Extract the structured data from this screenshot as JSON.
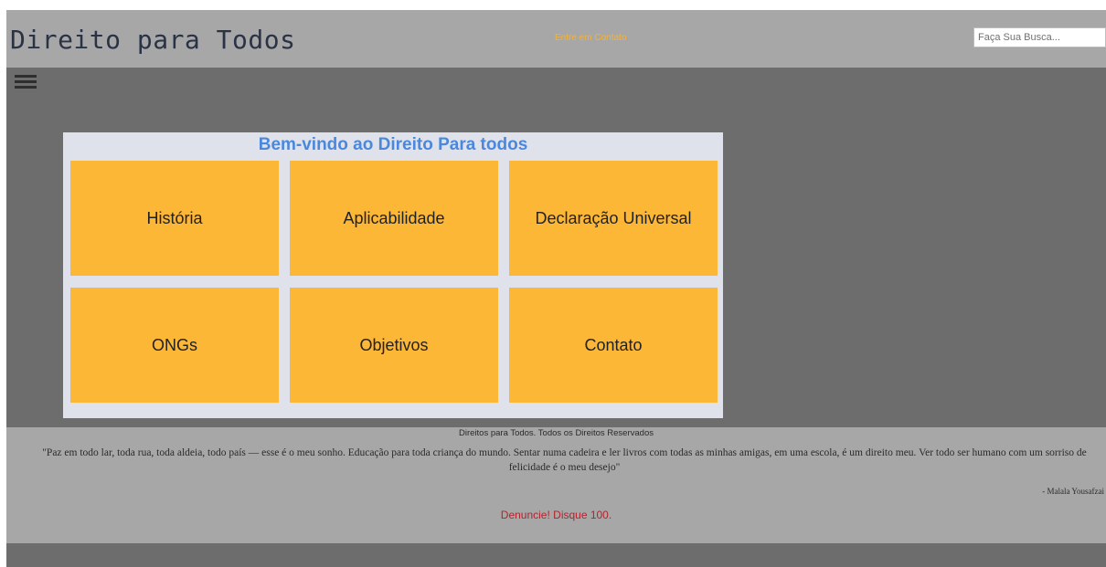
{
  "header": {
    "title": "Direito para Todos",
    "contact_link": "Entre em Contato",
    "search_placeholder": "Faça Sua Busca..."
  },
  "menu": {
    "icon": "hamburger-menu-icon"
  },
  "welcome": {
    "title": "Bem-vindo ao Direito Para todos",
    "tiles": [
      {
        "label": "História"
      },
      {
        "label": "Aplicabilidade"
      },
      {
        "label": "Declaração Universal"
      },
      {
        "label": "ONGs"
      },
      {
        "label": "Objetivos"
      },
      {
        "label": "Contato"
      }
    ]
  },
  "footer": {
    "copyright": "Direitos para Todos. Todos os Direitos Reservados",
    "quote": "\"Paz em todo lar, toda rua, toda aldeia, todo país — esse é o meu sonho. Educação para toda criança do mundo. Sentar numa cadeira e ler livros com todas as minhas amigas, em uma escola, é um direito meu. Ver todo ser humano com um sorriso de felicidade é o meu desejo\"",
    "quote_author": "- Malala Yousafzai",
    "hotline": "Denuncie! Disque 100."
  },
  "colors": {
    "header_bg": "#a7a7a7",
    "page_bg": "#6d6d6d",
    "panel_bg": "#dfe2ea",
    "tile_bg": "#fdb737",
    "title_accent": "#4b88dc",
    "contact_link": "#f4b23a",
    "hotline": "#b0252d"
  }
}
